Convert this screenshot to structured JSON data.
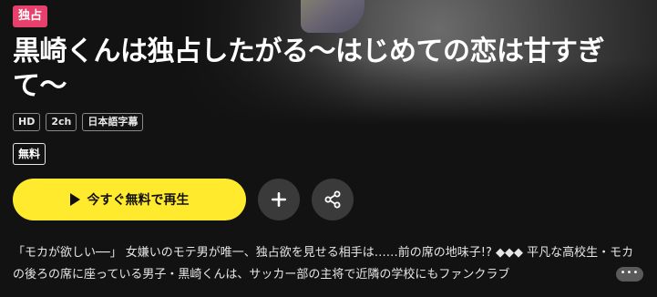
{
  "badge": {
    "exclusive": "独占"
  },
  "title": "黒崎くんは独占したがる〜はじめての恋は甘すぎて〜",
  "meta_tags": [
    "HD",
    "2ch",
    "日本語字幕"
  ],
  "free_tag": "無料",
  "actions": {
    "play_label": "今すぐ無料で再生",
    "add_icon": "plus-icon",
    "share_icon": "share-icon",
    "more_label": "•••"
  },
  "description": "「モカが欲しい──」 女嫌いのモテ男が唯一、独占欲を見せる相手は……前の席の地味子!? ◆◆◆ 平凡な高校生・モカの後ろの席に座っている男子・黒崎くんは、サッカー部の主将で近隣の学校にもファンクラブ",
  "colors": {
    "accent_yellow": "#ffea2e",
    "exclusive_pink": "#e6406c",
    "background": "#121212"
  }
}
